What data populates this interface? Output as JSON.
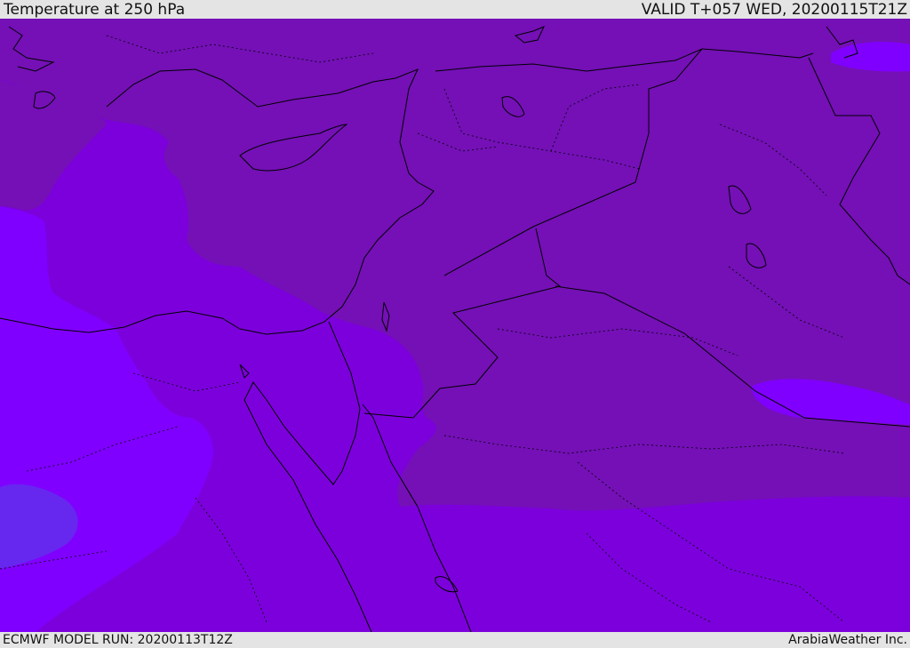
{
  "header": {
    "title": "Temperature at 250 hPa",
    "valid": "VALID T+057 WED, 20200115T21Z"
  },
  "footer": {
    "model_run": "ECMWF MODEL RUN: 20200113T12Z",
    "credit": "ArabiaWeather Inc."
  },
  "colors": {
    "band_dark": "#7410b6",
    "band_mid": "#7c00dc",
    "band_light": "#8000ff",
    "band_blue": "#6628ee",
    "coast": "#000000",
    "background": "#e4e4e4"
  }
}
